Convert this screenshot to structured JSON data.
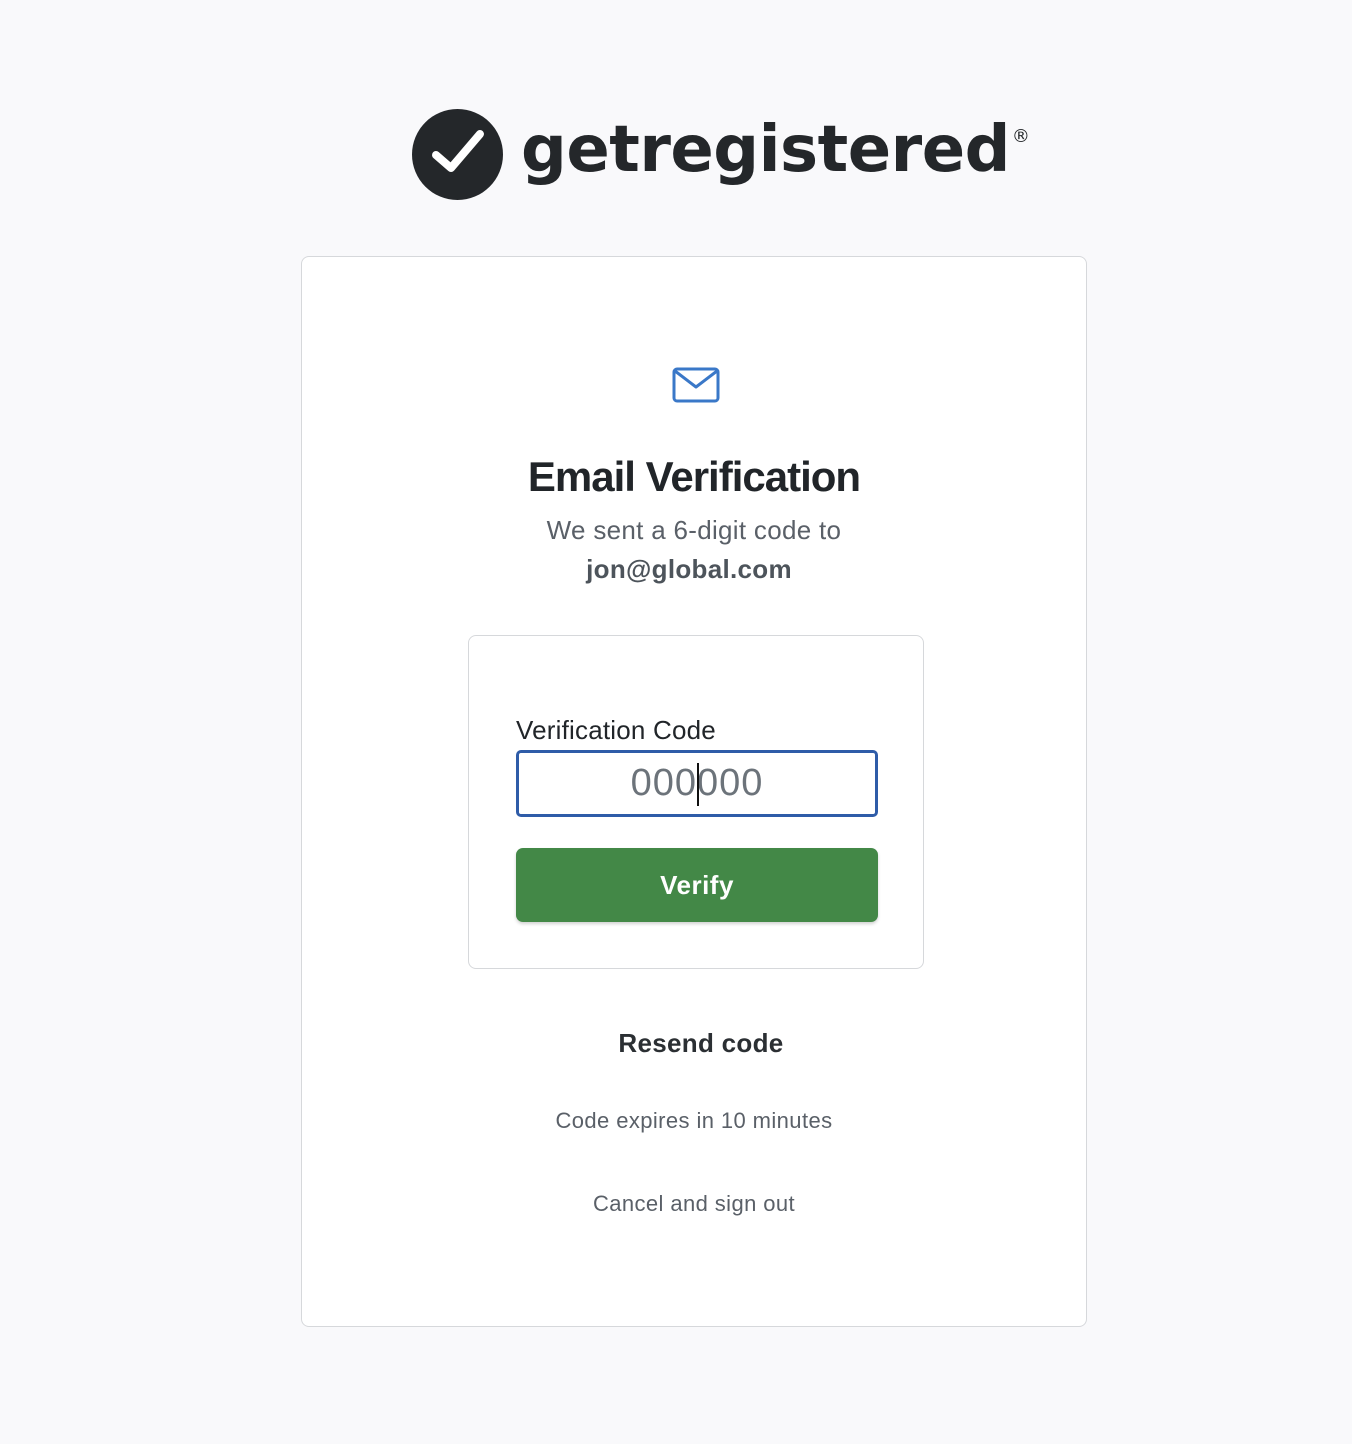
{
  "brand": {
    "name": "getregistered",
    "registered_mark": "®",
    "logo_icon": "check-circle-icon"
  },
  "card": {
    "icon": "envelope-icon",
    "title": "Email Verification",
    "subtitle": "We sent a 6-digit code to",
    "email": "jon@global.com"
  },
  "form": {
    "label": "Verification Code",
    "input_placeholder": "000000",
    "input_value": "",
    "verify_label": "Verify"
  },
  "footer": {
    "resend_label": "Resend code",
    "expires_text": "Code expires in 10 minutes",
    "cancel_label": "Cancel and sign out"
  },
  "colors": {
    "background": "#f9f9fb",
    "brand_dark": "#24272a",
    "accent_blue": "#2f5ca8",
    "icon_blue": "#3a78c8",
    "button_green": "#438847"
  }
}
